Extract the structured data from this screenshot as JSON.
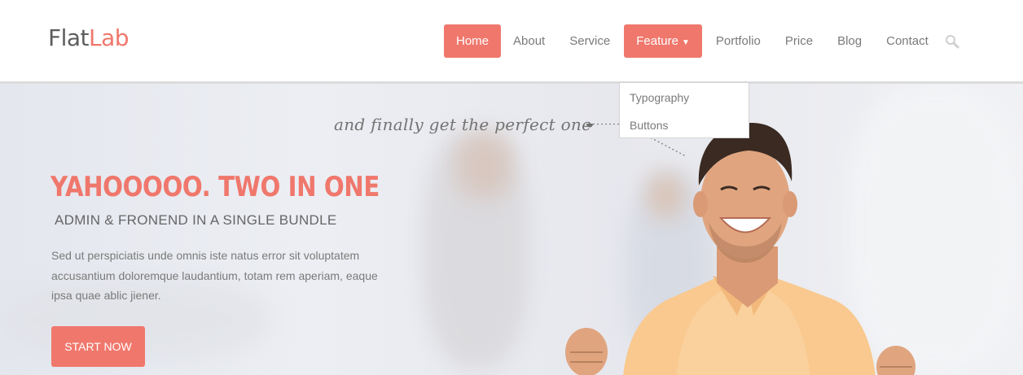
{
  "logo": {
    "part1": "Flat",
    "part2": "Lab"
  },
  "nav": {
    "items": [
      {
        "label": "Home",
        "active": true
      },
      {
        "label": "About"
      },
      {
        "label": "Service"
      },
      {
        "label": "Feature",
        "active": true,
        "has_dropdown": true
      },
      {
        "label": "Portfolio"
      },
      {
        "label": "Price"
      },
      {
        "label": "Blog"
      },
      {
        "label": "Contact"
      }
    ],
    "search_icon": "search-icon"
  },
  "dropdown": {
    "items": [
      {
        "label": "Typography"
      },
      {
        "label": "Buttons"
      }
    ]
  },
  "hero": {
    "tagline": "and finally get the perfect one",
    "title": "YAHOOOOO. TWO IN ONE",
    "subtitle": "ADMIN & FRONEND IN A SINGLE BUNDLE",
    "description": "Sed ut perspiciatis unde omnis iste natus error sit voluptatem accusantium doloremque laudantium, totam rem aperiam, eaque ipsa quae ablic jiener.",
    "cta_label": "START NOW"
  },
  "colors": {
    "accent": "#f0776c",
    "text": "#7a7a7a",
    "logo_dark": "#5d5d5d"
  }
}
